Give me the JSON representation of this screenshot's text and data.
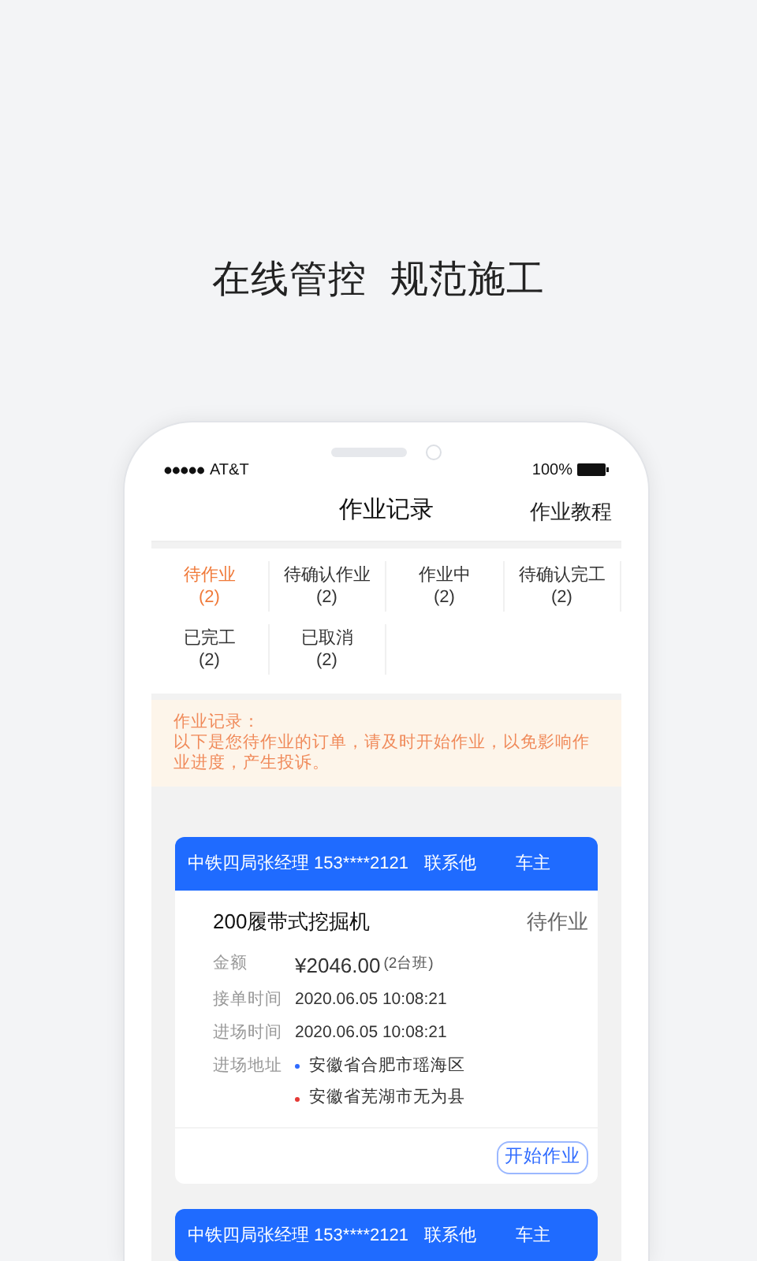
{
  "headline": "在线管控  规范施工",
  "status_bar": {
    "carrier": "AT&T",
    "battery": "100%"
  },
  "nav": {
    "title": "作业记录",
    "action": "作业教程"
  },
  "tabs": [
    {
      "label": "待作业",
      "count": "(2)",
      "selected": true
    },
    {
      "label": "待确认作业",
      "count": "(2)",
      "selected": false
    },
    {
      "label": "作业中",
      "count": "(2)",
      "selected": false
    },
    {
      "label": "待确认完工",
      "count": "(2)",
      "selected": false
    },
    {
      "label": "已完工",
      "count": "(2)",
      "selected": false
    },
    {
      "label": "已取消",
      "count": "(2)",
      "selected": false
    }
  ],
  "notice": {
    "title": "作业记录：",
    "text": "以下是您待作业的订单，请及时开始作业，以免影响作业进度，产生投诉。"
  },
  "orders": [
    {
      "contact_name": "中铁四局张经理 153****2121",
      "contact_link": "联系他",
      "role": "车主",
      "title": "200履带式挖掘机",
      "status": "待作业",
      "amount_label": "金额",
      "amount": "¥2046.00",
      "amount_note": "(2台班)",
      "fields": [
        {
          "label": "接单时间",
          "value": "2020.06.05 10:08:21"
        },
        {
          "label": "进场时间",
          "value": "2020.06.05 10:08:21"
        }
      ],
      "address_label": "进场地址",
      "addresses": [
        {
          "text": "安徽省合肥市瑶海区",
          "color": "#2f6bff"
        },
        {
          "text": "安徽省芜湖市无为县",
          "color": "#e53935"
        }
      ],
      "button": "开始作业"
    },
    {
      "contact_name": "中铁四局张经理 153****2121",
      "contact_link": "联系他",
      "role": "车主"
    }
  ]
}
